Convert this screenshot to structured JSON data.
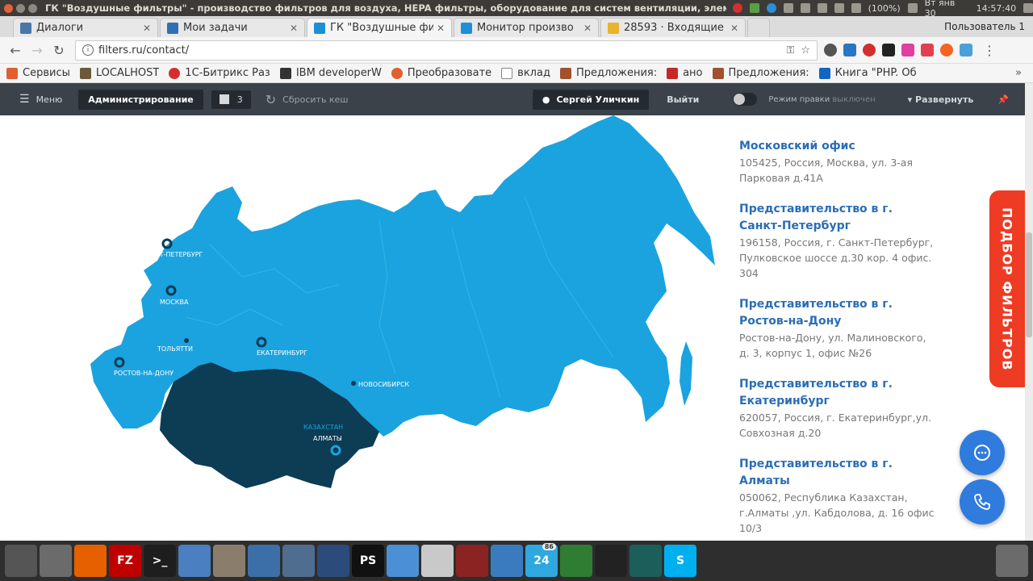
{
  "os": {
    "window_title": "ГК \"Воздушные фильтры\" - производство фильтров для воздуха, HEPA фильтры, оборудование для систем вентиляции, элемент",
    "battery": "(100%)",
    "datetime": "Вт янв 30",
    "time": "14:57:40"
  },
  "tabs": [
    {
      "label": "Диалоги",
      "color": "#4a76a8"
    },
    {
      "label": "Мои задачи",
      "color": "#2f6fb5"
    },
    {
      "label": "ГК \"Воздушные фи",
      "color": "#1e8fd5"
    },
    {
      "label": "Монитор произво",
      "color": "#1e8fd5"
    },
    {
      "label": "28593 · Входящие ·",
      "color": "#e7b42a"
    }
  ],
  "profile": "Пользователь 1",
  "address": {
    "url": "filters.ru/contact/"
  },
  "bookmarks": [
    {
      "label": "Сервисы",
      "color": "#e0602f"
    },
    {
      "label": "LOCALHOST",
      "color": "#6b5a3a"
    },
    {
      "label": "1С-Битрикс Раз",
      "color": "#d32f2f"
    },
    {
      "label": "IBM developerW",
      "color": "#333333"
    },
    {
      "label": "Преобразовате",
      "color": "#e0602f"
    },
    {
      "label": "вклад",
      "color": "#ffffff"
    },
    {
      "label": "Предложения: ",
      "color": "#a0522d"
    },
    {
      "label": "ано",
      "color": "#c62828"
    },
    {
      "label": "Предложения: ",
      "color": "#a0522d"
    },
    {
      "label": "Книга \"PHP. Об",
      "color": "#1565c0"
    }
  ],
  "admin": {
    "menu": "Меню",
    "administration": "Администрирование",
    "notifications": "3",
    "reset_cache": "Сбросить кеш",
    "user": "Сергей Уличкин",
    "logout": "Выйти",
    "edit_mode": "Режим правки",
    "edit_mode_state": "выключен",
    "expand": "Развернуть"
  },
  "map": {
    "russia_color": "#1aa3df",
    "kazakhstan_color": "#0d3c55",
    "cities": [
      {
        "name": "САНКТ-ПЕТЕРБУРГ",
        "office": true
      },
      {
        "name": "МОСКВА",
        "office": true
      },
      {
        "name": "ТОЛЬЯТТИ",
        "office": false
      },
      {
        "name": "ЕКАТЕРИНБУРГ",
        "office": true
      },
      {
        "name": "РОСТОВ-НА-ДОНУ",
        "office": true
      },
      {
        "name": "НОВОСИБИРСК",
        "office": false
      },
      {
        "name": "АЛМАТЫ",
        "office": true
      }
    ],
    "country_label": "КАЗАХСТАН"
  },
  "offices": [
    {
      "name": "Московский офис",
      "address": "105425, Россия, Москва, ул. 3-ая Парковая д.41А"
    },
    {
      "name": "Представительство в г. Санкт-Петербург",
      "address": "196158, Россия, г. Санкт-Петербург, Пулковское шоссе д.30 кор. 4 офис. 304"
    },
    {
      "name": "Представительство в г. Ростов-на-Дону",
      "address": "Ростов-на-Дону, ул. Малиновского, д. 3, корпус 1, офис №26"
    },
    {
      "name": "Представительство в г. Екатеринбург",
      "address": "620057, Россия, г. Екатеринбург,ул. Совхозная д.20"
    },
    {
      "name": "Представительство в г. Алматы",
      "address": "050062, Республика Казахстан, г.Алматы ,ул. Кабдолова, д. 16 офис 10/3"
    }
  ],
  "filter_tab": "ПОДБОР ФИЛЬТРОВ",
  "dock": [
    {
      "icon": "settings-icon",
      "label": "",
      "color": "#555555"
    },
    {
      "icon": "files-icon",
      "label": "",
      "color": "#6b6b6b"
    },
    {
      "icon": "firefox-icon",
      "label": "",
      "color": "#e66000"
    },
    {
      "icon": "filezilla-icon",
      "label": "FZ",
      "color": "#bf0000"
    },
    {
      "icon": "terminal-icon",
      "label": ">_",
      "color": "#1e1e1e"
    },
    {
      "icon": "document-icon",
      "label": "",
      "color": "#4a7fc1"
    },
    {
      "icon": "archive-icon",
      "label": "",
      "color": "#8a7d6b"
    },
    {
      "icon": "pipette-icon",
      "label": "",
      "color": "#3c6fa8"
    },
    {
      "icon": "screenshot-icon",
      "label": "",
      "color": "#4f6d8f"
    },
    {
      "icon": "space-icon",
      "label": "",
      "color": "#2b4b7a"
    },
    {
      "icon": "phpstorm-icon",
      "label": "PS",
      "color": "#111111"
    },
    {
      "icon": "chromium-icon",
      "label": "",
      "color": "#4b8fd6"
    },
    {
      "icon": "editor-icon",
      "label": "",
      "color": "#c9c9c9"
    },
    {
      "icon": "mysql-icon",
      "label": "",
      "color": "#8b2323"
    },
    {
      "icon": "monitor-icon",
      "label": "",
      "color": "#3a7bbf"
    },
    {
      "icon": "bitrix24-icon",
      "label": "24",
      "color": "#2fa8e0",
      "badge": "86"
    },
    {
      "icon": "spreadsheet-icon",
      "label": "",
      "color": "#2e7d32"
    },
    {
      "icon": "inkscape-icon",
      "label": "",
      "color": "#222222"
    },
    {
      "icon": "gitkraken-icon",
      "label": "",
      "color": "#1b5e5a"
    },
    {
      "icon": "skype-icon",
      "label": "S",
      "color": "#00aff0"
    }
  ]
}
